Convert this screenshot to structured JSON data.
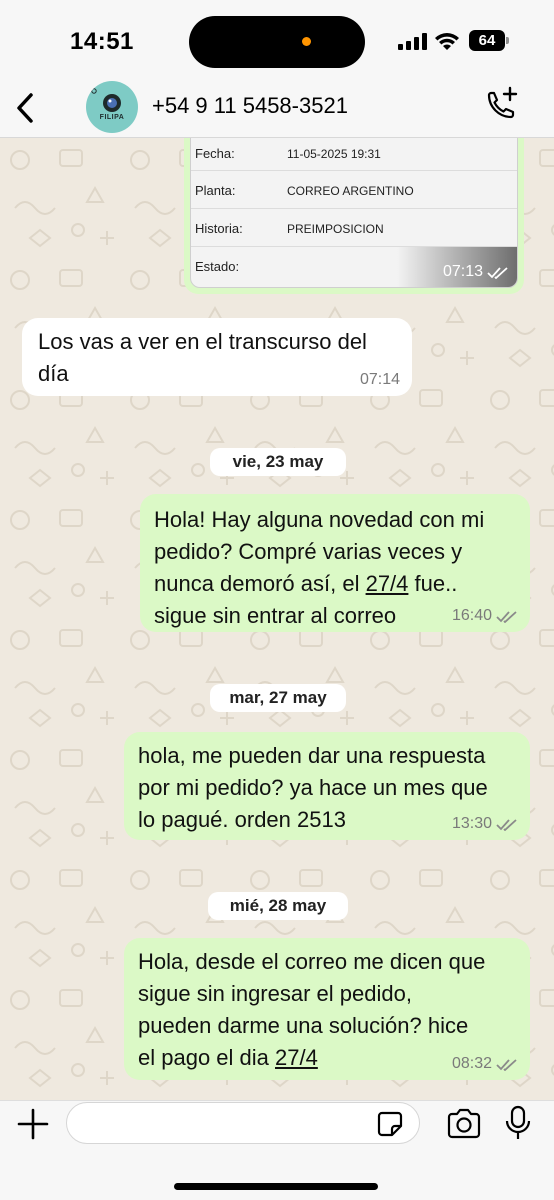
{
  "status_bar": {
    "time": "14:51",
    "battery": "64",
    "icons": [
      "signal-icon",
      "wifi-icon",
      "battery-icon"
    ]
  },
  "header": {
    "contact_name": "+54 9 11 5458-3521",
    "avatar_text": "FILIPA",
    "icons": [
      "chevron-left-icon",
      "phone-add-icon"
    ]
  },
  "image_message": {
    "rows": [
      {
        "label": "Fecha:",
        "value": "11-05-2025 19:31"
      },
      {
        "label": "Planta:",
        "value": "CORREO ARGENTINO"
      },
      {
        "label": "Historia:",
        "value": "PREIMPOSICION"
      },
      {
        "label": "Estado:",
        "value": ""
      }
    ],
    "time": "07:13"
  },
  "messages": [
    {
      "direction": "in",
      "text_lines": [
        "Los vas a ver en el transcurso del",
        "día"
      ],
      "time": "07:14"
    },
    {
      "direction": "out",
      "text_lines": [
        "Hola! Hay alguna novedad con mi",
        "pedido? Compré varias veces y",
        "nunca demoró así, el 27/4 fue..",
        "sigue sin entrar al correo"
      ],
      "time": "16:40"
    },
    {
      "direction": "out",
      "text_lines": [
        "hola, me pueden dar una respuesta",
        "por mi pedido? ya hace un mes que",
        "lo pagué. orden 2513"
      ],
      "time": "13:30"
    },
    {
      "direction": "out",
      "text_lines": [
        "Hola, desde el correo me dicen que",
        "sigue sin ingresar el pedido,",
        "pueden darme una solución? hice",
        "el pago el dia 27/4"
      ],
      "time": "08:32"
    }
  ],
  "date_separators": [
    "vie, 23 may",
    "mar, 27 may",
    "mié, 28 may"
  ],
  "input_bar": {
    "placeholder": "",
    "icons": [
      "plus-icon",
      "sticker-icon",
      "camera-icon",
      "microphone-icon"
    ]
  },
  "colors": {
    "outgoing_bubble": "#dbf9c6",
    "incoming_bubble": "#ffffff",
    "wallpaper": "#efe9df",
    "read_ticks": "#8a8a8a"
  }
}
